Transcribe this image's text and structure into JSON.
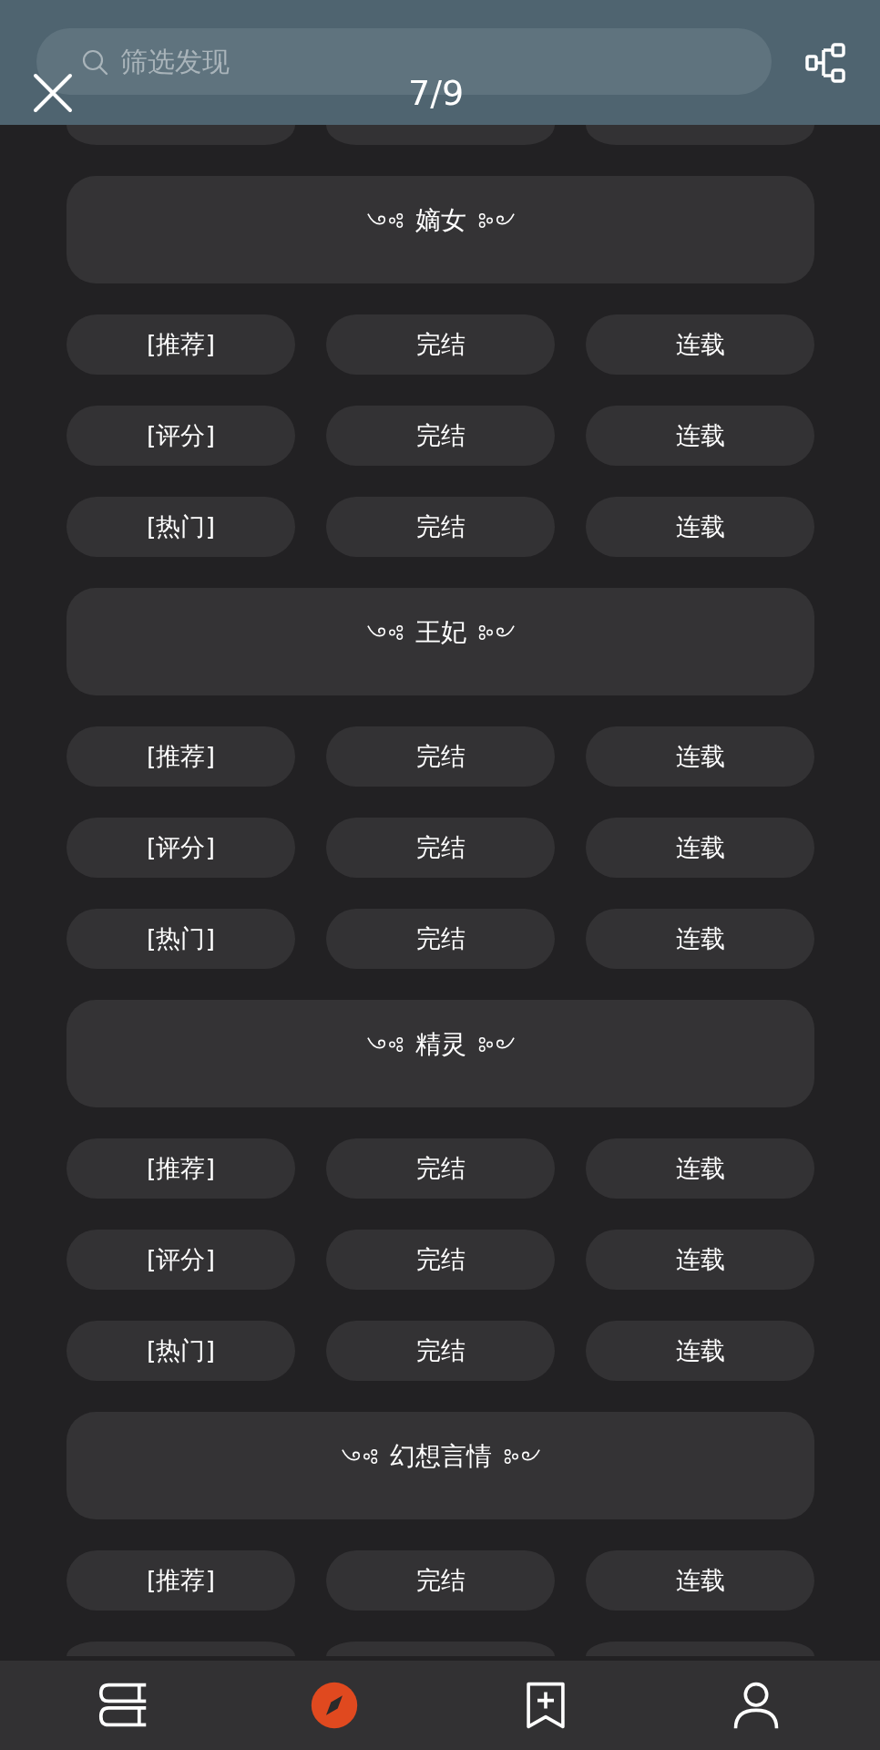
{
  "top_bar": {
    "search": {
      "placeholder": "筛选发现"
    },
    "page_counter": "7/9"
  },
  "sections": [
    {
      "title": "嫡女",
      "rows": [
        {
          "cells": [
            "[推荐]",
            "完结",
            "连载"
          ]
        },
        {
          "cells": [
            "[评分]",
            "完结",
            "连载"
          ]
        },
        {
          "cells": [
            "[热门]",
            "完结",
            "连载"
          ]
        }
      ]
    },
    {
      "title": "王妃",
      "rows": [
        {
          "cells": [
            "[推荐]",
            "完结",
            "连载"
          ]
        },
        {
          "cells": [
            "[评分]",
            "完结",
            "连载"
          ]
        },
        {
          "cells": [
            "[热门]",
            "完结",
            "连载"
          ]
        }
      ]
    },
    {
      "title": "精灵",
      "rows": [
        {
          "cells": [
            "[推荐]",
            "完结",
            "连载"
          ]
        },
        {
          "cells": [
            "[评分]",
            "完结",
            "连载"
          ]
        },
        {
          "cells": [
            "[热门]",
            "完结",
            "连载"
          ]
        }
      ]
    },
    {
      "title": "幻想言情",
      "rows": [
        {
          "cells": [
            "[推荐]",
            "完结",
            "连载"
          ]
        }
      ]
    }
  ],
  "bottom_nav": [
    {
      "selected": false
    },
    {
      "selected": true
    },
    {
      "selected": false
    },
    {
      "selected": false
    }
  ]
}
